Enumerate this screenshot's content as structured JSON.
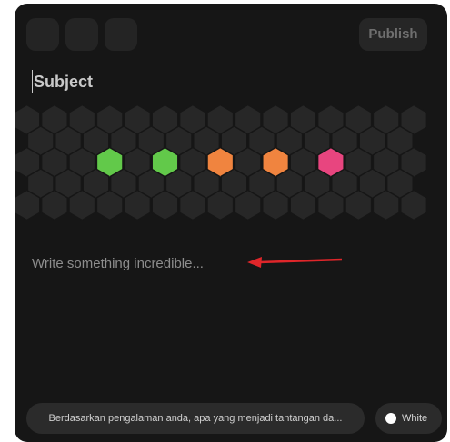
{
  "toolbar": {
    "tools": [
      "tool-1",
      "tool-2",
      "tool-3"
    ],
    "publish_label": "Publish"
  },
  "editor": {
    "subject_placeholder": "Subject",
    "body_placeholder": "Write something incredible..."
  },
  "mood_grid": {
    "highlight_colors": [
      "#62c94a",
      "#62c94a",
      "#f0843f",
      "#f0843f",
      "#e8457f"
    ],
    "base_color": "#272727"
  },
  "footer": {
    "prompt_text": "Berdasarkan pengalaman anda, apa yang menjadi tantangan da...",
    "theme_label": "White"
  },
  "annotation": {
    "arrow_color": "#e0262a"
  }
}
